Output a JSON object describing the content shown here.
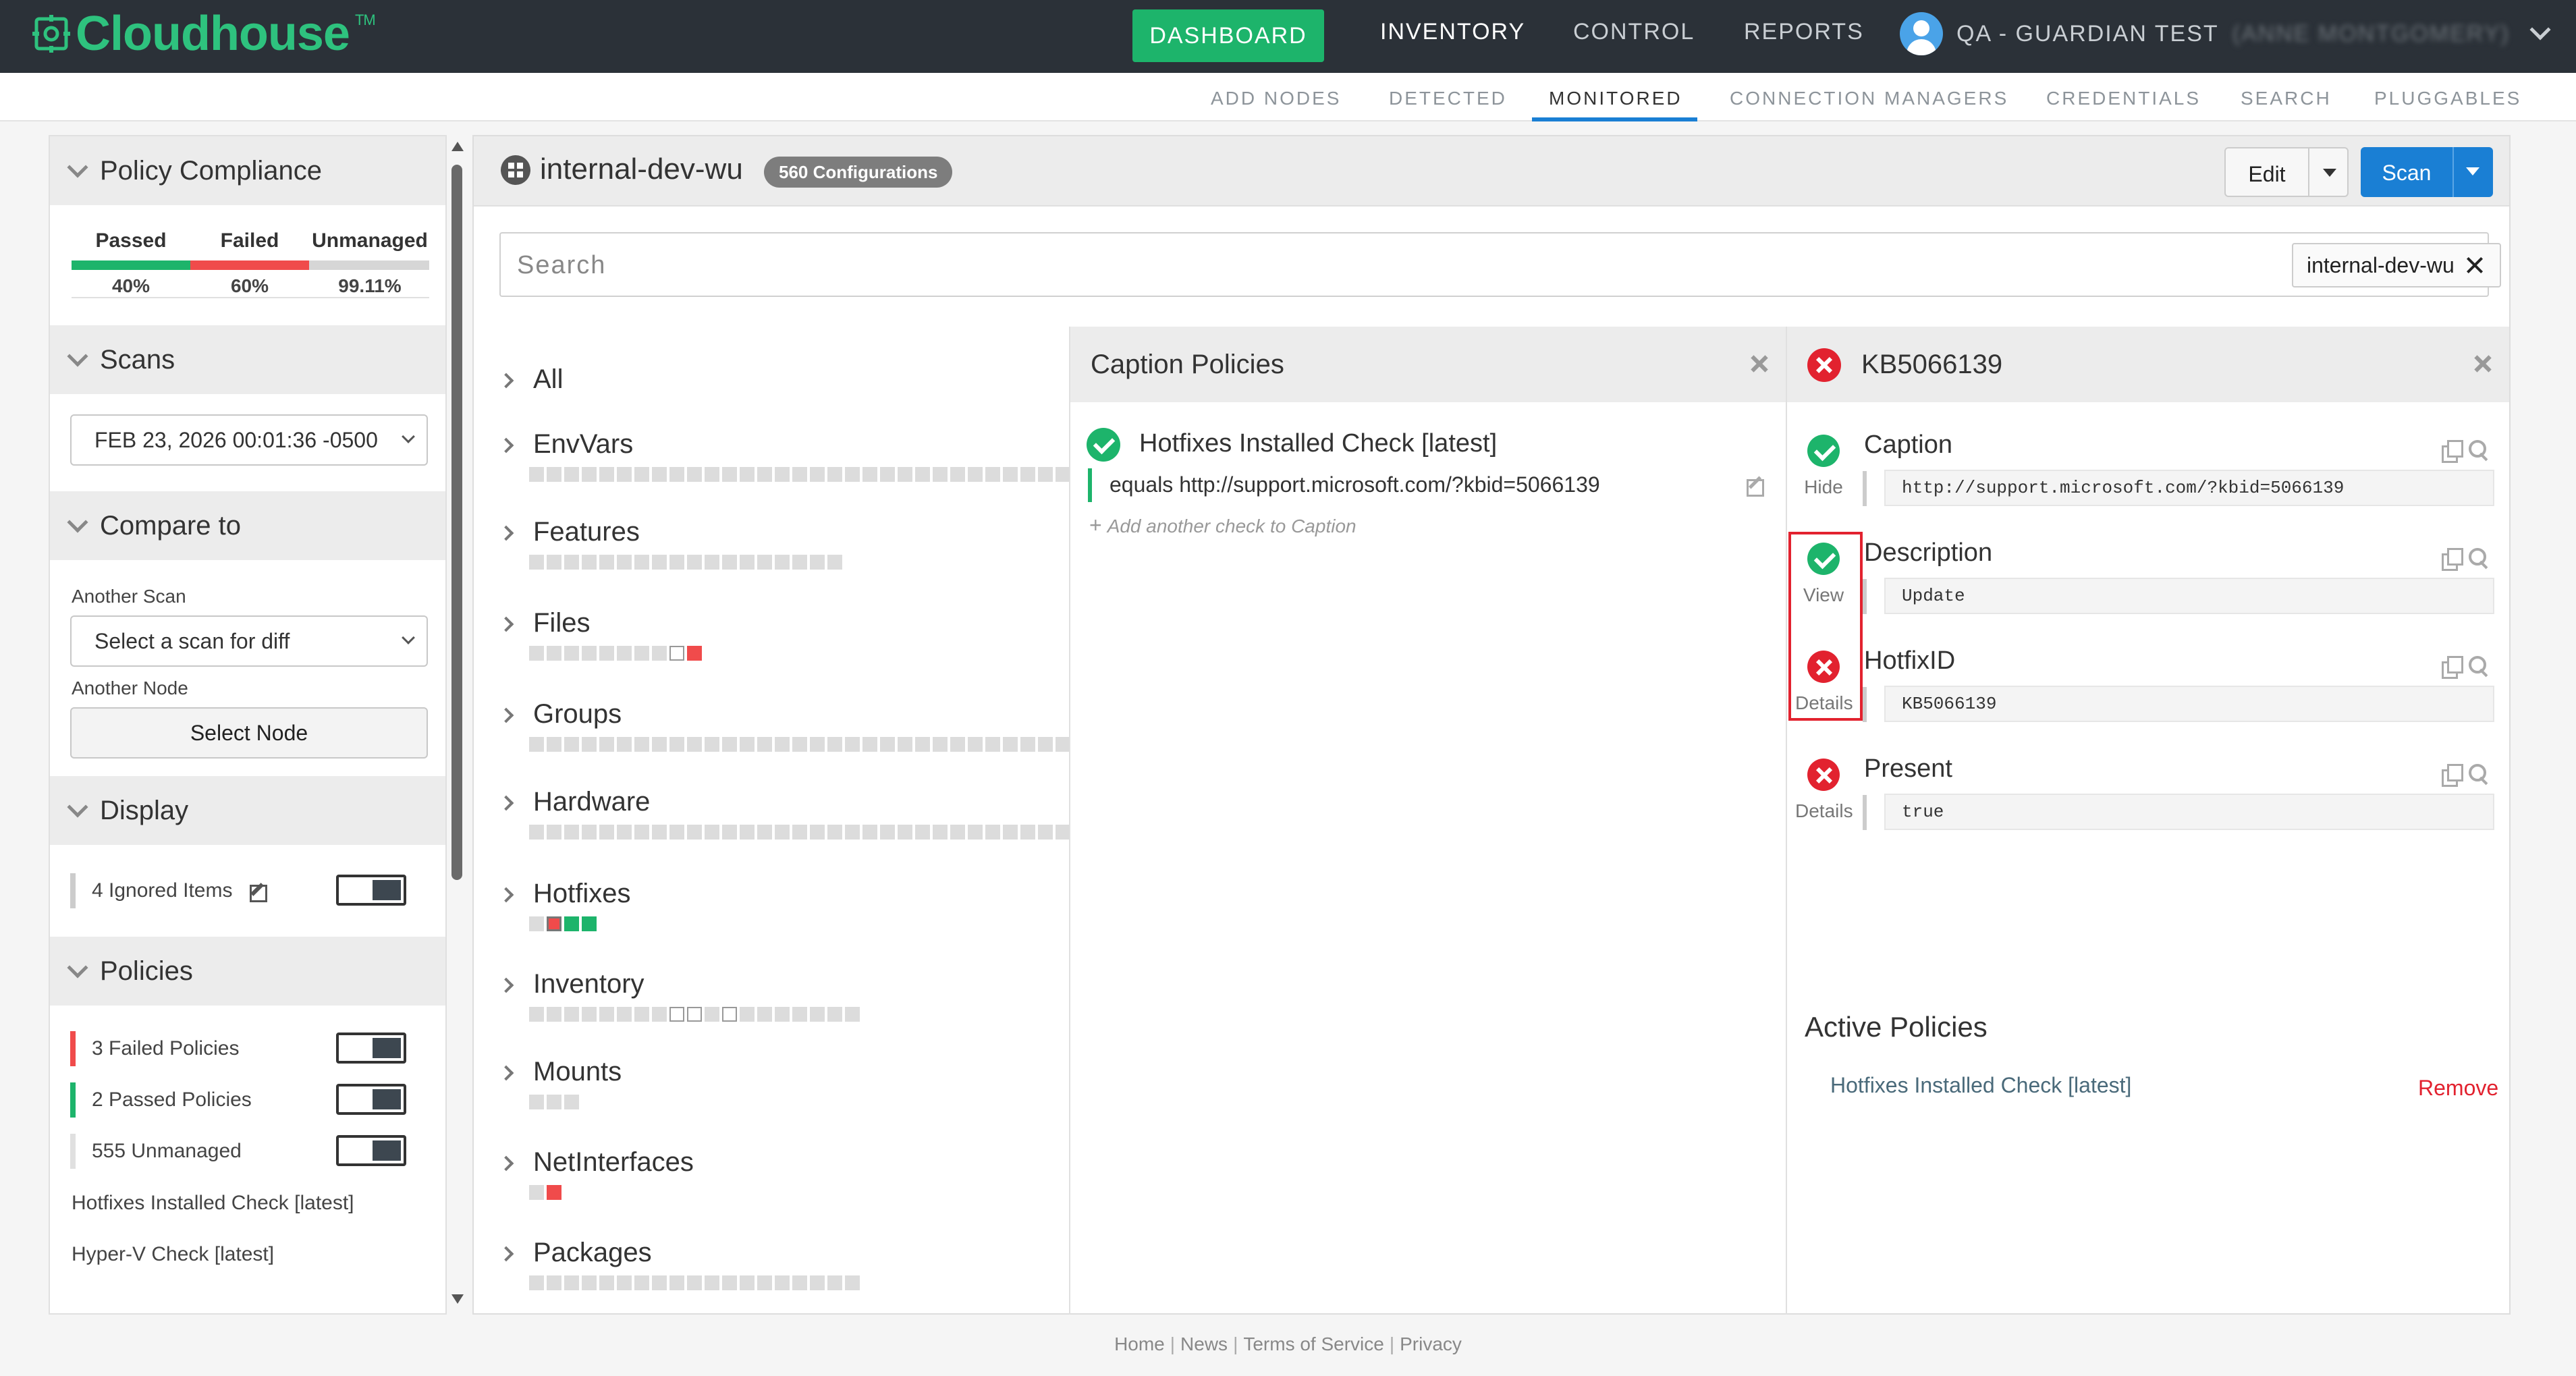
{
  "brand": {
    "name": "Cloudhouse",
    "tm": "TM",
    "color": "#2ec27e"
  },
  "topnav": {
    "dashboard": "DASHBOARD",
    "inventory": "INVENTORY",
    "control": "CONTROL",
    "reports": "REPORTS",
    "user_label": "QA - GUARDIAN TEST",
    "user_name": "(ANNE MONTGOMERY)"
  },
  "subnav": {
    "items": [
      "ADD NODES",
      "DETECTED",
      "MONITORED",
      "CONNECTION MANAGERS",
      "CREDENTIALS",
      "SEARCH",
      "PLUGGABLES"
    ],
    "active": "MONITORED"
  },
  "sidebar": {
    "policy_compliance": {
      "title": "Policy Compliance",
      "passed_label": "Passed",
      "failed_label": "Failed",
      "unmanaged_label": "Unmanaged",
      "passed_value": "40%",
      "failed_value": "60%",
      "unmanaged_value": "99.11%"
    },
    "scans": {
      "title": "Scans",
      "selected": "FEB 23, 2026 00:01:36 -0500"
    },
    "compare": {
      "title": "Compare to",
      "another_scan_label": "Another Scan",
      "scan_select": "Select a scan for diff",
      "another_node_label": "Another Node",
      "select_node_button": "Select Node"
    },
    "display": {
      "title": "Display",
      "ignored_items": "4 Ignored Items"
    },
    "policies": {
      "title": "Policies",
      "failed": "3 Failed Policies",
      "passed": "2 Passed Policies",
      "unmanaged": "555 Unmanaged",
      "list": [
        "Hotfixes Installed Check [latest]",
        "Hyper-V Check [latest]"
      ]
    }
  },
  "main": {
    "node_name": "internal-dev-wu",
    "config_badge": "560 Configurations",
    "edit_button": "Edit",
    "scan_button": "Scan",
    "search_placeholder": "Search",
    "filter_chip": "internal-dev-wu"
  },
  "categories": {
    "all": "All",
    "items": [
      {
        "name": "EnvVars",
        "squares": "gggggggggggggggggggggggggggggggggggggggggg"
      },
      {
        "name": "Features",
        "squares": "gggggggggggggggggg"
      },
      {
        "name": "Files",
        "squares": "ggggggggor"
      },
      {
        "name": "Groups",
        "squares": "gggggggggggggggggggggggggggggggg"
      },
      {
        "name": "Hardware",
        "squares": "gggggggggggggggggggggggggggggggggggggggg"
      },
      {
        "name": "Hotfixes",
        "squares": "gRGG"
      },
      {
        "name": "Inventory",
        "squares": "ggggggggoogoggggggg"
      },
      {
        "name": "Mounts",
        "squares": "ggg"
      },
      {
        "name": "NetInterfaces",
        "squares": "gr"
      },
      {
        "name": "Packages",
        "squares": "ggggggggggggggggggg"
      }
    ]
  },
  "caption_policies": {
    "title": "Caption Policies",
    "policy_name": "Hotfixes Installed Check [latest]",
    "check": "equals http://support.microsoft.com/?kbid=5066139",
    "add_check": "Add another check to Caption"
  },
  "detail": {
    "title": "KB5066139",
    "attributes": [
      {
        "name": "Caption",
        "state": "ok",
        "state_label": "Hide",
        "value": "http://support.microsoft.com/?kbid=5066139"
      },
      {
        "name": "Description",
        "state": "ok",
        "state_label": "View",
        "value": "Update"
      },
      {
        "name": "HotfixID",
        "state": "fail",
        "state_label": "Details",
        "value": "KB5066139"
      },
      {
        "name": "Present",
        "state": "fail",
        "state_label": "Details",
        "value": "true"
      }
    ],
    "active_policies_title": "Active Policies",
    "active_policy": "Hotfixes Installed Check [latest]",
    "remove": "Remove"
  },
  "footer": {
    "links": [
      "Home",
      "News",
      "Terms of Service",
      "Privacy"
    ]
  },
  "colors": {
    "accent": "#1a7fd4",
    "pass": "#1db46b",
    "fail": "#e2222f"
  }
}
